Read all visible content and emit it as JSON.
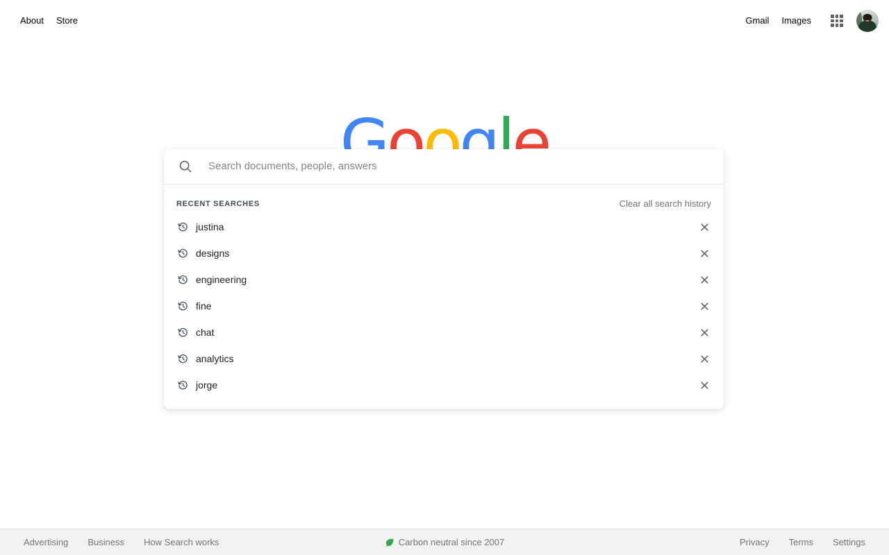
{
  "header": {
    "left_links": [
      {
        "label": "About",
        "name": "about"
      },
      {
        "label": "Store",
        "name": "store"
      }
    ],
    "right_links": [
      {
        "label": "Gmail",
        "name": "gmail"
      },
      {
        "label": "Images",
        "name": "images"
      }
    ],
    "apps_icon": "apps-grid-icon",
    "avatar_icon": "user-avatar"
  },
  "logo": {
    "letters": [
      {
        "char": "G",
        "color": "#4285F4"
      },
      {
        "char": "o",
        "color": "#EA4335"
      },
      {
        "char": "o",
        "color": "#FBBC05"
      },
      {
        "char": "g",
        "color": "#4285F4"
      },
      {
        "char": "l",
        "color": "#34A853"
      },
      {
        "char": "e",
        "color": "#EA4335"
      }
    ]
  },
  "search": {
    "icon": "search-icon",
    "value": "",
    "placeholder": "Search documents, people, answers"
  },
  "recent": {
    "title": "RECENT SEARCHES",
    "clear_label": "Clear all search history",
    "item_icon": "history-clock-icon",
    "remove_icon": "close-x-icon",
    "items": [
      {
        "label": "justina"
      },
      {
        "label": "designs"
      },
      {
        "label": "engineering"
      },
      {
        "label": "fine"
      },
      {
        "label": "chat"
      },
      {
        "label": "analytics"
      },
      {
        "label": "jorge"
      }
    ]
  },
  "footer": {
    "left_links": [
      {
        "label": "Advertising",
        "name": "advertising"
      },
      {
        "label": "Business",
        "name": "business"
      },
      {
        "label": "How Search works",
        "name": "how-search-works"
      }
    ],
    "center": {
      "icon": "leaf-icon",
      "label": "Carbon neutral since 2007"
    },
    "right_links": [
      {
        "label": "Privacy",
        "name": "privacy"
      },
      {
        "label": "Terms",
        "name": "terms"
      },
      {
        "label": "Settings",
        "name": "settings"
      }
    ]
  },
  "colors": {
    "accent_blue": "#4285F4",
    "accent_red": "#EA4335",
    "accent_yellow": "#FBBC05",
    "accent_green": "#34A853",
    "text_primary": "#202124",
    "text_secondary": "#70757a",
    "footer_bg": "#f2f2f2"
  }
}
